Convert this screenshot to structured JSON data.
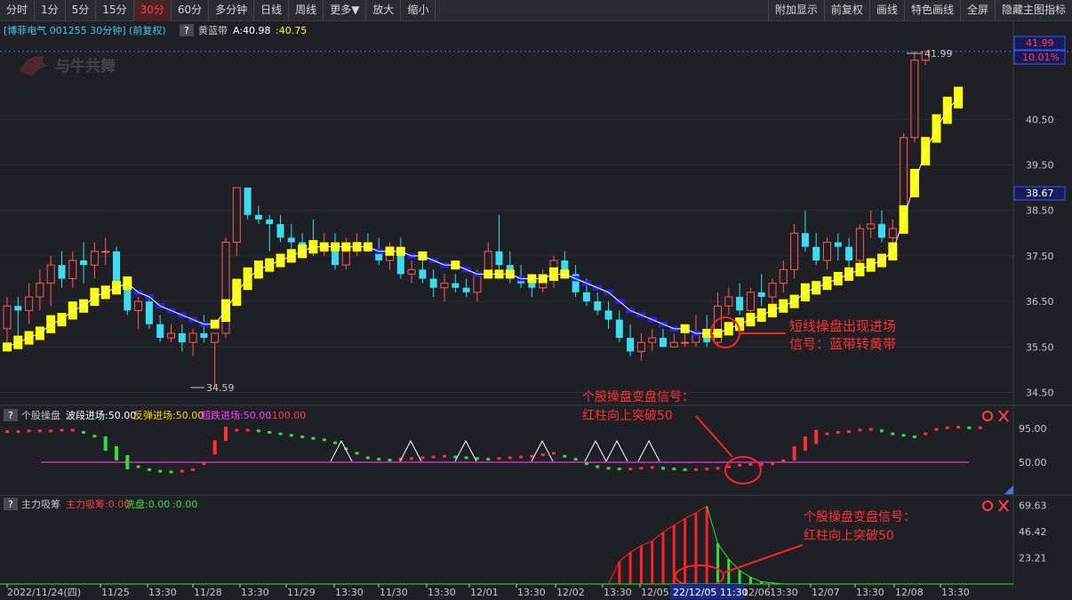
{
  "toolbar": {
    "left": [
      "分时",
      "1分",
      "5分",
      "15分",
      "30分",
      "60分",
      "多分钟",
      "日线",
      "周线",
      "更多▼",
      "放大",
      "缩小"
    ],
    "active": "30分",
    "right": [
      "附加显示",
      "前复权",
      "画线",
      "特色画线",
      "全屏",
      "隐藏主图指标"
    ]
  },
  "main_panel": {
    "stock_title": "[博菲电气 001255 30分钟] (前复权)",
    "help_mark": "?",
    "indicator_name": "黄蓝带",
    "indicator_a": "A:40.98",
    "indicator_b": ":40.75",
    "watermark": "与牛共舞",
    "price_high_label": "41.99",
    "price_low_label": "34.59",
    "right_tag_price": "41.99",
    "right_tag_pct": "10.01%",
    "right_tag_current": "38.67",
    "annotation_main": [
      "短线操盘出现进场",
      "信号：蓝带转黄带"
    ]
  },
  "osc_panel": {
    "help_mark": "?",
    "name": "个股操盘",
    "legend": [
      {
        "text": "波段进场:50.00",
        "color": "#ffffff"
      },
      {
        "text": "反弹进场:50.00",
        "color": "#ffd700"
      },
      {
        "text": "超跌进场:50.00",
        "color": "#ff3cff"
      },
      {
        "text": ":100.00",
        "color": "#ff3b3b"
      }
    ],
    "annotation": [
      "个股操盘变盘信号：",
      "红柱向上突破50"
    ]
  },
  "flow_panel": {
    "help_mark": "?",
    "name": "主力吸筹",
    "legend": [
      {
        "text": "主力吸筹:0.00",
        "color": "#ff3b3b"
      },
      {
        "text": "洗盘:0.00",
        "color": "#3cdc3c"
      },
      {
        "text": ":0.00",
        "color": "#3cdc3c"
      }
    ],
    "annotation": [
      "个股操盘变盘信号：",
      "红柱向上突破50"
    ]
  },
  "x_axis": {
    "labels": [
      "2022/11/24(四)",
      "11/25",
      "13:30",
      "11/28",
      "13:30",
      "11/29",
      "13:30",
      "11/30",
      "13:30",
      "12/01",
      "13:30",
      "12/02",
      "13:30",
      "12/05",
      "13:30",
      "12/06",
      "13:30",
      "12/07",
      "13:30",
      "12/08",
      "13:30"
    ],
    "cursor_label": "22/12/05 11:30"
  },
  "chart_data": [
    {
      "type": "candlestick",
      "title": "博菲电气 001255 30分钟 (前复权)",
      "y_ticks": [
        34.5,
        35.5,
        36.5,
        37.5,
        38.5,
        39.5,
        40.5
      ],
      "ylim": [
        34.3,
        41.99
      ],
      "series_note": "overlay 黄蓝带 band: yellow = rising, blue = falling",
      "ohlc": [
        [
          35.9,
          36.6,
          35.6,
          36.4
        ],
        [
          36.4,
          36.6,
          35.5,
          36.3
        ],
        [
          36.3,
          36.9,
          36.0,
          36.6
        ],
        [
          36.6,
          37.2,
          36.3,
          36.9
        ],
        [
          36.9,
          37.5,
          36.4,
          37.3
        ],
        [
          37.3,
          37.6,
          36.8,
          37.0
        ],
        [
          37.0,
          37.6,
          36.8,
          37.4
        ],
        [
          37.4,
          37.8,
          36.9,
          37.3
        ],
        [
          37.3,
          37.8,
          37.0,
          37.6
        ],
        [
          37.6,
          37.9,
          37.3,
          37.6
        ],
        [
          37.6,
          37.7,
          36.8,
          36.9
        ],
        [
          36.9,
          37.0,
          36.2,
          36.3
        ],
        [
          36.3,
          36.6,
          35.9,
          36.5
        ],
        [
          36.5,
          36.6,
          35.9,
          36.0
        ],
        [
          36.0,
          36.2,
          35.6,
          35.7
        ],
        [
          35.7,
          36.0,
          35.6,
          35.8
        ],
        [
          35.8,
          36.0,
          35.4,
          35.6
        ],
        [
          35.6,
          35.9,
          35.3,
          35.8
        ],
        [
          35.8,
          36.2,
          35.6,
          35.7
        ],
        [
          35.6,
          35.8,
          34.6,
          35.8
        ],
        [
          35.8,
          37.9,
          35.7,
          37.8
        ],
        [
          37.8,
          39.0,
          37.5,
          39.0
        ],
        [
          39.0,
          39.0,
          38.3,
          38.4
        ],
        [
          38.4,
          38.6,
          38.2,
          38.3
        ],
        [
          38.3,
          38.4,
          37.6,
          38.2
        ],
        [
          38.2,
          38.4,
          37.8,
          37.9
        ],
        [
          37.9,
          38.2,
          37.6,
          37.8
        ],
        [
          37.8,
          38.0,
          37.6,
          37.7
        ],
        [
          37.7,
          38.3,
          37.5,
          37.6
        ],
        [
          37.6,
          38.0,
          37.5,
          37.7
        ],
        [
          37.7,
          38.0,
          37.2,
          37.3
        ],
        [
          37.3,
          37.9,
          37.2,
          37.6
        ],
        [
          37.6,
          38.0,
          37.5,
          37.8
        ],
        [
          37.8,
          38.0,
          37.6,
          37.6
        ],
        [
          37.6,
          37.9,
          37.3,
          37.4
        ],
        [
          37.4,
          37.8,
          37.2,
          37.7
        ],
        [
          37.7,
          37.9,
          37.0,
          37.1
        ],
        [
          37.1,
          37.4,
          36.9,
          37.2
        ],
        [
          37.2,
          37.5,
          36.9,
          37.0
        ],
        [
          37.0,
          37.2,
          36.6,
          36.8
        ],
        [
          36.8,
          37.1,
          36.5,
          36.9
        ],
        [
          36.9,
          37.1,
          36.7,
          36.8
        ],
        [
          36.8,
          37.0,
          36.6,
          36.7
        ],
        [
          36.7,
          37.2,
          36.5,
          37.1
        ],
        [
          37.1,
          37.8,
          37.0,
          37.6
        ],
        [
          37.6,
          38.4,
          37.2,
          37.3
        ],
        [
          37.3,
          37.6,
          36.9,
          37.0
        ],
        [
          37.0,
          37.3,
          36.8,
          36.9
        ],
        [
          36.9,
          37.1,
          36.6,
          36.8
        ],
        [
          36.8,
          37.2,
          36.7,
          37.0
        ],
        [
          37.0,
          37.5,
          36.8,
          37.4
        ],
        [
          37.4,
          37.6,
          37.0,
          37.1
        ],
        [
          37.1,
          37.3,
          36.6,
          36.7
        ],
        [
          36.7,
          37.0,
          36.4,
          36.5
        ],
        [
          36.5,
          36.7,
          36.2,
          36.3
        ],
        [
          36.3,
          36.5,
          35.9,
          36.1
        ],
        [
          36.1,
          36.3,
          35.6,
          35.7
        ],
        [
          35.7,
          36.0,
          35.3,
          35.4
        ],
        [
          35.4,
          35.8,
          35.2,
          35.6
        ],
        [
          35.6,
          35.9,
          35.4,
          35.7
        ],
        [
          35.7,
          35.9,
          35.5,
          35.5
        ],
        [
          35.5,
          35.8,
          35.5,
          35.6
        ],
        [
          35.6,
          35.8,
          35.5,
          35.6
        ],
        [
          35.6,
          36.2,
          35.5,
          35.8
        ],
        [
          35.8,
          36.2,
          35.5,
          35.6
        ],
        [
          35.6,
          36.7,
          35.5,
          36.4
        ],
        [
          36.4,
          36.8,
          36.2,
          36.6
        ],
        [
          36.6,
          36.9,
          36.2,
          36.3
        ],
        [
          36.3,
          36.8,
          36.2,
          36.7
        ],
        [
          36.7,
          37.1,
          36.4,
          36.6
        ],
        [
          36.6,
          37.0,
          36.4,
          36.9
        ],
        [
          36.9,
          37.4,
          36.7,
          37.2
        ],
        [
          37.2,
          38.2,
          37.0,
          38.0
        ],
        [
          38.0,
          38.5,
          37.6,
          37.7
        ],
        [
          37.7,
          38.0,
          37.3,
          37.4
        ],
        [
          37.4,
          37.9,
          37.2,
          37.8
        ],
        [
          37.8,
          38.0,
          37.4,
          37.7
        ],
        [
          37.7,
          37.9,
          37.2,
          37.4
        ],
        [
          37.4,
          38.2,
          37.3,
          38.1
        ],
        [
          38.1,
          38.5,
          37.9,
          38.2
        ],
        [
          38.2,
          38.5,
          37.8,
          37.9
        ],
        [
          37.9,
          38.3,
          37.6,
          38.1
        ],
        [
          38.1,
          40.2,
          38.0,
          40.1
        ],
        [
          40.1,
          41.99,
          40.0,
          41.8
        ],
        [
          41.8,
          41.99,
          41.7,
          41.99
        ]
      ],
      "band": [
        35.5,
        35.6,
        35.7,
        35.8,
        36.0,
        36.1,
        36.3,
        36.4,
        36.6,
        36.7,
        36.8,
        36.9,
        36.7,
        36.6,
        36.4,
        36.3,
        36.2,
        36.1,
        36.0,
        36.0,
        36.3,
        36.7,
        37.0,
        37.2,
        37.3,
        37.4,
        37.5,
        37.6,
        37.7,
        37.7,
        37.7,
        37.7,
        37.7,
        37.7,
        37.6,
        37.6,
        37.6,
        37.5,
        37.5,
        37.4,
        37.3,
        37.3,
        37.2,
        37.1,
        37.1,
        37.1,
        37.1,
        37.0,
        37.0,
        37.0,
        37.1,
        37.1,
        37.0,
        36.9,
        36.8,
        36.7,
        36.5,
        36.3,
        36.2,
        36.1,
        36.0,
        35.9,
        35.9,
        35.8,
        35.8,
        35.8,
        35.9,
        36.0,
        36.1,
        36.2,
        36.3,
        36.4,
        36.5,
        36.7,
        36.8,
        36.9,
        37.0,
        37.1,
        37.2,
        37.3,
        37.4,
        37.6,
        38.3,
        39.1,
        39.8,
        40.3,
        40.7,
        40.98
      ]
    },
    {
      "type": "dot-series",
      "title": "个股操盘",
      "y_ticks": [
        50.0,
        95.0
      ],
      "ylim": [
        30,
        105
      ],
      "reference_line": 50,
      "values": [
        91,
        91,
        92,
        92,
        92,
        93,
        93,
        90,
        85,
        75,
        62,
        50,
        44,
        40,
        38,
        37,
        38,
        40,
        48,
        70,
        88,
        93,
        93,
        92,
        90,
        88,
        86,
        84,
        82,
        80,
        76,
        68,
        62,
        56,
        54,
        53,
        54,
        55,
        56,
        57,
        58,
        57,
        56,
        55,
        54,
        55,
        56,
        57,
        58,
        60,
        62,
        58,
        54,
        48,
        44,
        42,
        41,
        41,
        42,
        43,
        42,
        41,
        40,
        40,
        41,
        42,
        44,
        46,
        47,
        47,
        48,
        52,
        62,
        75,
        84,
        88,
        90,
        91,
        93,
        94,
        92,
        88,
        86,
        84,
        88,
        94,
        96,
        97,
        96,
        96
      ],
      "colors_note": "red rising, green falling",
      "peak_markers_count": 6
    },
    {
      "type": "bar",
      "title": "主力吸筹",
      "y_ticks": [
        23.21,
        46.42,
        69.63
      ],
      "ylim": [
        0,
        72
      ],
      "red_bars": [
        {
          "index": 56,
          "value": 20
        },
        {
          "index": 57,
          "value": 28
        },
        {
          "index": 58,
          "value": 34
        },
        {
          "index": 59,
          "value": 38
        },
        {
          "index": 60,
          "value": 46
        },
        {
          "index": 61,
          "value": 52
        },
        {
          "index": 62,
          "value": 58
        },
        {
          "index": 63,
          "value": 63
        },
        {
          "index": 64,
          "value": 69
        }
      ],
      "green_bars": [
        {
          "index": 65,
          "value": 36
        },
        {
          "index": 66,
          "value": 22
        },
        {
          "index": 67,
          "value": 12
        },
        {
          "index": 68,
          "value": 6
        },
        {
          "index": 69,
          "value": 2
        }
      ]
    }
  ],
  "colors": {
    "background": "#1f1f26",
    "up": "#ff5a5a",
    "down": "#3cdcf0",
    "band_up": "#ffff00",
    "band_down": "#2020ff",
    "accent_red": "#ff3b3b",
    "reference_line": "#c832c8"
  }
}
